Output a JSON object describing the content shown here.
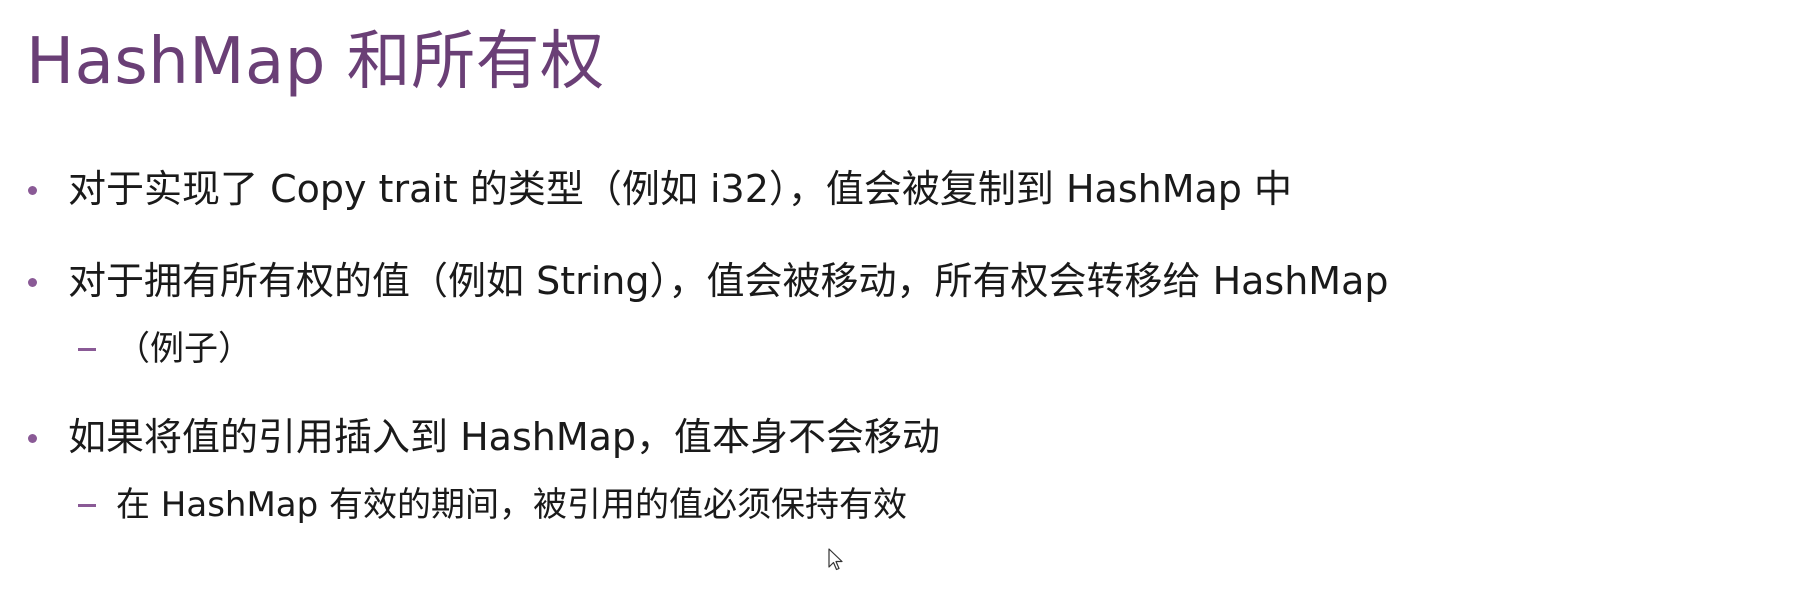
{
  "slide": {
    "title": "HashMap 和所有权",
    "bullets": [
      {
        "text": "对于实现了 Copy trait 的类型（例如 i32），值会被复制到 HashMap 中",
        "sub": []
      },
      {
        "text": "对于拥有所有权的值（例如 String），值会被移动，所有权会转移给 HashMap",
        "sub": [
          "（例子）"
        ]
      },
      {
        "text": "如果将值的引用插入到 HashMap，值本身不会移动",
        "sub": [
          "在 HashMap 有效的期间，被引用的值必须保持有效"
        ]
      }
    ]
  },
  "colors": {
    "title": "#6a3f76",
    "bullet_marker": "#8a5a96",
    "text": "#1a1a1a"
  },
  "icons": {
    "cursor": "mouse-pointer-icon"
  }
}
